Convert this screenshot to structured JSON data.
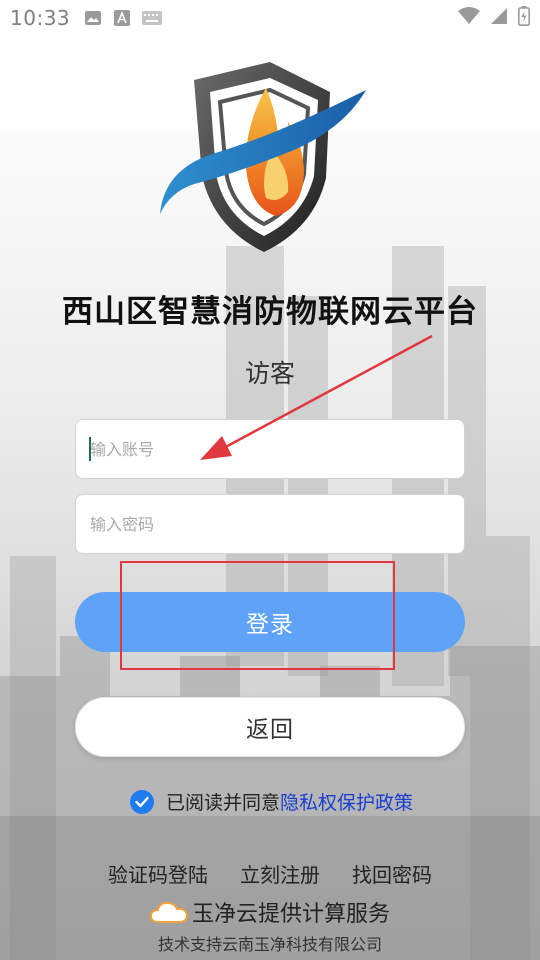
{
  "status_bar": {
    "time": "10:33",
    "icons": [
      "image-icon",
      "text-a-icon",
      "keyboard-icon",
      "wifi-icon",
      "cellular-icon",
      "battery-icon"
    ]
  },
  "app": {
    "title": "西山区智慧消防物联网云平台",
    "guest_label": "访客"
  },
  "login_form": {
    "account_placeholder": "输入账号",
    "password_placeholder": "输入密码",
    "login_label": "登录",
    "back_label": "返回"
  },
  "agreement": {
    "prefix": "已阅读并同意",
    "policy_link": "隐私权保护政策",
    "checked": true
  },
  "links": {
    "sms_login": "验证码登陆",
    "register": "立刻注册",
    "forgot_password": "找回密码"
  },
  "footer": {
    "provider": "玉净云提供计算服务",
    "support": "技术支持云南玉净科技有限公司"
  },
  "colors": {
    "accent": "#5fa3f8",
    "check": "#1d7cf0",
    "link": "#1a3fd0",
    "annotation": "#e0383e"
  }
}
